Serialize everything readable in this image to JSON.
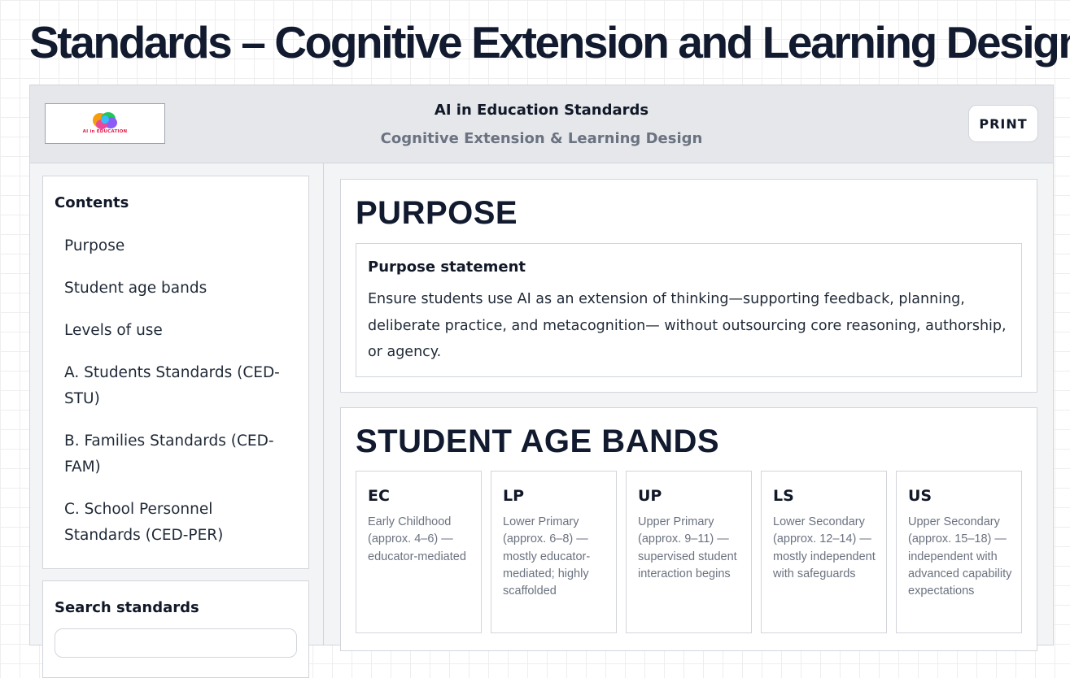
{
  "page": {
    "title": "Standards – Cognitive Extension and Learning Design"
  },
  "header": {
    "logo_text": "AI in EDUCATION",
    "title": "AI in Education Standards",
    "subtitle": "Cognitive Extension & Learning Design",
    "print_label": "PRINT"
  },
  "sidebar": {
    "contents_heading": "Contents",
    "items": [
      {
        "label": "Purpose"
      },
      {
        "label": "Student age bands"
      },
      {
        "label": "Levels of use"
      },
      {
        "label": "A. Students Standards (CED-STU)"
      },
      {
        "label": "B. Families Standards (CED-FAM)"
      },
      {
        "label": "C. School Personnel Standards (CED-PER)"
      }
    ],
    "search_heading": "Search standards"
  },
  "purpose": {
    "title": "PURPOSE",
    "statement_heading": "Purpose statement",
    "statement_body": "Ensure students use AI as an extension of thinking—supporting feedback, planning, deliberate practice, and metacognition— without outsourcing core reasoning, authorship, or agency."
  },
  "age_bands": {
    "title": "STUDENT AGE BANDS",
    "bands": [
      {
        "code": "EC",
        "description": "Early Childhood (approx. 4–6) — educator-mediated"
      },
      {
        "code": "LP",
        "description": "Lower Primary (approx. 6–8) — mostly educator-mediated; highly scaffolded"
      },
      {
        "code": "UP",
        "description": "Upper Primary (approx. 9–11) — supervised student interaction begins"
      },
      {
        "code": "LS",
        "description": "Lower Secondary (approx. 12–14) — mostly independent with safeguards"
      },
      {
        "code": "US",
        "description": "Upper Secondary (approx. 15–18) — independent with advanced capability expectations"
      }
    ]
  },
  "colors": {
    "heading": "#111a2e",
    "muted_text": "#6b7280",
    "panel_bg": "#f3f4f6",
    "header_bg": "#e5e7eb",
    "border": "#d1d5db"
  }
}
